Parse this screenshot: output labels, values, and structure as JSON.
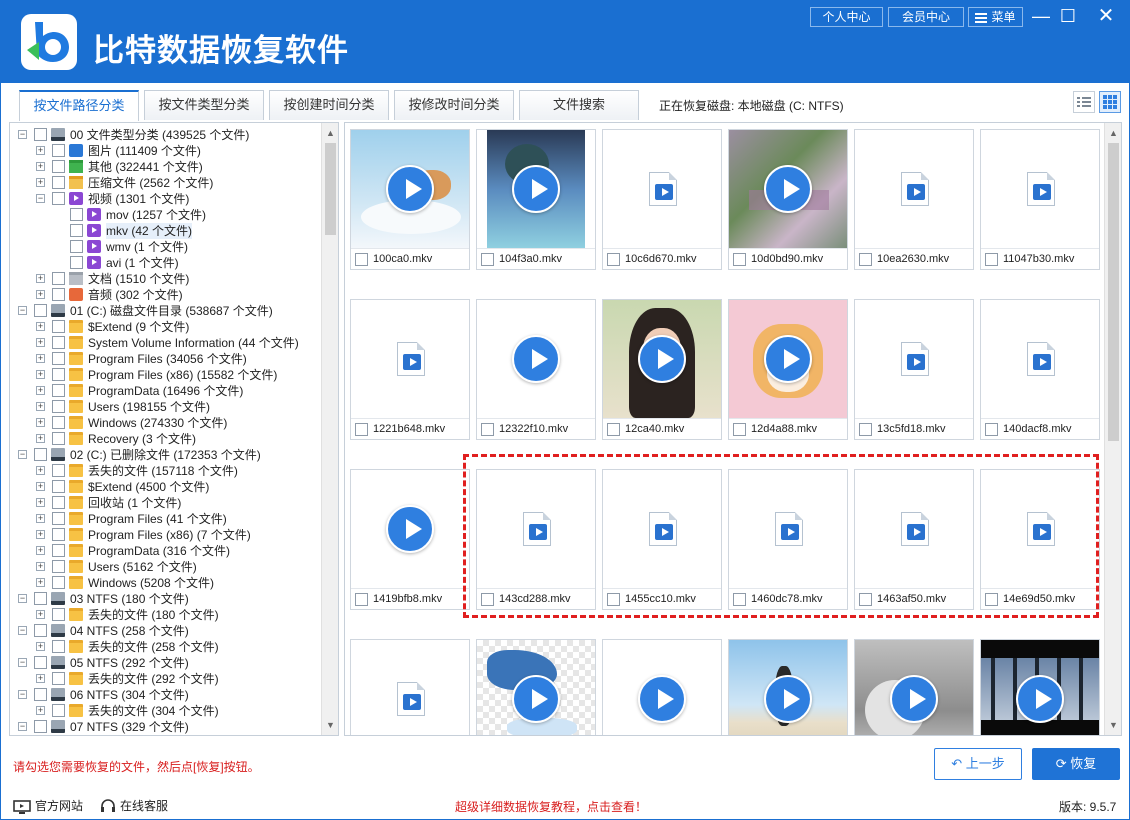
{
  "app": {
    "title": "比特数据恢复软件"
  },
  "topbar": {
    "personal": "个人中心",
    "member": "会员中心",
    "menu": "菜单"
  },
  "tabs": [
    {
      "label": "按文件路径分类",
      "active": true
    },
    {
      "label": "按文件类型分类",
      "active": false
    },
    {
      "label": "按创建时间分类",
      "active": false
    },
    {
      "label": "按修改时间分类",
      "active": false
    },
    {
      "label": "文件搜索",
      "active": false
    }
  ],
  "status": "正在恢复磁盘: 本地磁盘 (C: NTFS)",
  "tree": [
    {
      "label": "00 文件类型分类  (439525 个文件)",
      "level": 0,
      "icon": "drive",
      "exp": "−"
    },
    {
      "label": "图片   (111409 个文件)",
      "level": 1,
      "icon": "pic",
      "exp": "+"
    },
    {
      "label": "其他   (322441 个文件)",
      "level": 1,
      "icon": "folder-green",
      "exp": "+"
    },
    {
      "label": "压缩文件   (2562 个文件)",
      "level": 1,
      "icon": "zip",
      "exp": "+"
    },
    {
      "label": "视频   (1301 个文件)",
      "level": 1,
      "icon": "vid",
      "exp": "−"
    },
    {
      "label": "mov   (1257 个文件)",
      "level": 2,
      "icon": "vid",
      "exp": ""
    },
    {
      "label": "mkv   (42 个文件)",
      "level": 2,
      "icon": "vid",
      "exp": "",
      "selected": true
    },
    {
      "label": "wmv   (1 个文件)",
      "level": 2,
      "icon": "vid",
      "exp": ""
    },
    {
      "label": "avi   (1 个文件)",
      "level": 2,
      "icon": "vid",
      "exp": ""
    },
    {
      "label": "文档   (1510 个文件)",
      "level": 1,
      "icon": "folder-gray",
      "exp": "+"
    },
    {
      "label": "音频   (302 个文件)",
      "level": 1,
      "icon": "aud",
      "exp": "+"
    },
    {
      "label": "01 (C:) 磁盘文件目录  (538687 个文件)",
      "level": 0,
      "icon": "drive",
      "exp": "−"
    },
    {
      "label": "$Extend   (9 个文件)",
      "level": 1,
      "icon": "folder",
      "exp": "+"
    },
    {
      "label": "System Volume Information   (44 个文件)",
      "level": 1,
      "icon": "folder",
      "exp": "+"
    },
    {
      "label": "Program Files   (34056 个文件)",
      "level": 1,
      "icon": "folder",
      "exp": "+"
    },
    {
      "label": "Program Files (x86)   (15582 个文件)",
      "level": 1,
      "icon": "folder",
      "exp": "+"
    },
    {
      "label": "ProgramData   (16496 个文件)",
      "level": 1,
      "icon": "folder",
      "exp": "+"
    },
    {
      "label": "Users   (198155 个文件)",
      "level": 1,
      "icon": "folder",
      "exp": "+"
    },
    {
      "label": "Windows   (274330 个文件)",
      "level": 1,
      "icon": "folder",
      "exp": "+"
    },
    {
      "label": "Recovery   (3 个文件)",
      "level": 1,
      "icon": "folder",
      "exp": "+"
    },
    {
      "label": "02 (C:) 已删除文件  (172353 个文件)",
      "level": 0,
      "icon": "drive",
      "exp": "−"
    },
    {
      "label": "丢失的文件   (157118 个文件)",
      "level": 1,
      "icon": "folder",
      "exp": "+"
    },
    {
      "label": "$Extend   (4500 个文件)",
      "level": 1,
      "icon": "folder",
      "exp": "+"
    },
    {
      "label": "回收站   (1 个文件)",
      "level": 1,
      "icon": "folder",
      "exp": "+"
    },
    {
      "label": "Program Files   (41 个文件)",
      "level": 1,
      "icon": "folder",
      "exp": "+"
    },
    {
      "label": "Program Files (x86)   (7 个文件)",
      "level": 1,
      "icon": "folder",
      "exp": "+"
    },
    {
      "label": "ProgramData   (316 个文件)",
      "level": 1,
      "icon": "folder",
      "exp": "+"
    },
    {
      "label": "Users   (5162 个文件)",
      "level": 1,
      "icon": "folder",
      "exp": "+"
    },
    {
      "label": "Windows   (5208 个文件)",
      "level": 1,
      "icon": "folder",
      "exp": "+"
    },
    {
      "label": "03   NTFS  (180 个文件)",
      "level": 0,
      "icon": "drive",
      "exp": "−"
    },
    {
      "label": "丢失的文件   (180 个文件)",
      "level": 1,
      "icon": "folder",
      "exp": "+"
    },
    {
      "label": "04   NTFS  (258 个文件)",
      "level": 0,
      "icon": "drive",
      "exp": "−"
    },
    {
      "label": "丢失的文件   (258 个文件)",
      "level": 1,
      "icon": "folder",
      "exp": "+"
    },
    {
      "label": "05   NTFS  (292 个文件)",
      "level": 0,
      "icon": "drive",
      "exp": "−"
    },
    {
      "label": "丢失的文件   (292 个文件)",
      "level": 1,
      "icon": "folder",
      "exp": "+"
    },
    {
      "label": "06   NTFS  (304 个文件)",
      "level": 0,
      "icon": "drive",
      "exp": "−"
    },
    {
      "label": "丢失的文件   (304 个文件)",
      "level": 1,
      "icon": "folder",
      "exp": "+"
    },
    {
      "label": "07   NTFS  (329 个文件)",
      "level": 0,
      "icon": "drive",
      "exp": "−"
    }
  ],
  "files": [
    {
      "name": "100ca0.mkv",
      "thumb": "cat-cloud"
    },
    {
      "name": "104f3a0.mkv",
      "thumb": "anime"
    },
    {
      "name": "10c6d670.mkv",
      "thumb": "file"
    },
    {
      "name": "10d0bd90.mkv",
      "thumb": "glitch"
    },
    {
      "name": "10ea2630.mkv",
      "thumb": "file"
    },
    {
      "name": "11047b30.mkv",
      "thumb": "file"
    },
    {
      "name": "1221b648.mkv",
      "thumb": "file"
    },
    {
      "name": "12322f10.mkv",
      "thumb": "white-play"
    },
    {
      "name": "12ca40.mkv",
      "thumb": "girl"
    },
    {
      "name": "12d4a88.mkv",
      "thumb": "shiba"
    },
    {
      "name": "13c5fd18.mkv",
      "thumb": "file"
    },
    {
      "name": "140dacf8.mkv",
      "thumb": "file"
    },
    {
      "name": "1419bfb8.mkv",
      "thumb": "white-play"
    },
    {
      "name": "143cd288.mkv",
      "thumb": "file"
    },
    {
      "name": "1455cc10.mkv",
      "thumb": "file"
    },
    {
      "name": "1460dc78.mkv",
      "thumb": "file"
    },
    {
      "name": "1463af50.mkv",
      "thumb": "file"
    },
    {
      "name": "14e69d50.mkv",
      "thumb": "file"
    },
    {
      "name": "",
      "thumb": "file"
    },
    {
      "name": "",
      "thumb": "ski"
    },
    {
      "name": "",
      "thumb": "white-play"
    },
    {
      "name": "",
      "thumb": "beach"
    },
    {
      "name": "",
      "thumb": "bw"
    },
    {
      "name": "",
      "thumb": "city"
    }
  ],
  "hint": "请勾选您需要恢复的文件，然后点[恢复]按钮。",
  "buttons": {
    "back": "上一步",
    "recover": "恢复"
  },
  "footer": {
    "site": "官方网站",
    "service": "在线客服",
    "tutorial": "超级详细数据恢复教程，点击查看！",
    "version": "版本: 9.5.7"
  },
  "colors": {
    "brand": "#1a6fd1",
    "warn": "#d81e1e",
    "highlight": "#e01f1f"
  }
}
